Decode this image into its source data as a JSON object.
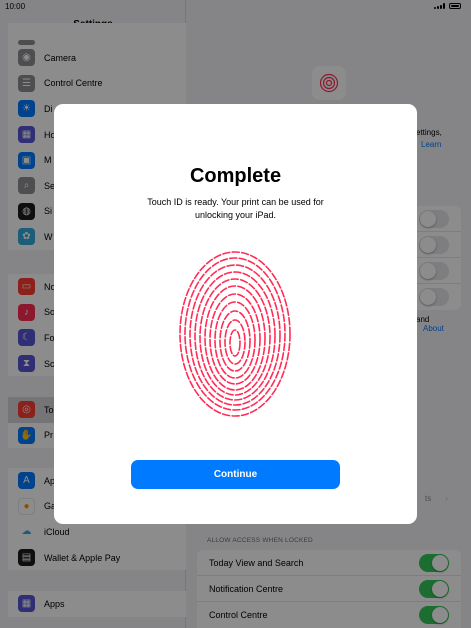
{
  "status_bar": {
    "time": "10:00"
  },
  "sidebar": {
    "title": "Settings",
    "groups": [
      {
        "items": [
          {
            "label": "",
            "icon": "generic-icon",
            "color": "#8e8e93"
          },
          {
            "label": "Camera",
            "icon": "camera-icon",
            "color": "#8e8e93"
          },
          {
            "label": "Control Centre",
            "icon": "control-centre-icon",
            "color": "#8e8e93"
          },
          {
            "label": "Di",
            "icon": "display-icon",
            "color": "#007aff"
          },
          {
            "label": "Ho",
            "icon": "home-screen-icon",
            "color": "#5856d6"
          },
          {
            "label": "M",
            "icon": "multitasking-icon",
            "color": "#007aff"
          },
          {
            "label": "Se",
            "icon": "search-icon",
            "color": "#8e8e93"
          },
          {
            "label": "Si",
            "icon": "siri-icon",
            "color": "#1c1c1e"
          },
          {
            "label": "W",
            "icon": "wallpaper-icon",
            "color": "#34aadc"
          }
        ]
      },
      {
        "items": [
          {
            "label": "No",
            "icon": "notifications-icon",
            "color": "#ff3b30"
          },
          {
            "label": "So",
            "icon": "sounds-icon",
            "color": "#ff2d55"
          },
          {
            "label": "Fo",
            "icon": "focus-icon",
            "color": "#5856d6"
          },
          {
            "label": "Sc",
            "icon": "screen-time-icon",
            "color": "#5856d6"
          }
        ]
      },
      {
        "items": [
          {
            "label": "To",
            "icon": "touch-id-icon",
            "color": "#ff3b30",
            "selected": true
          },
          {
            "label": "Pr",
            "icon": "privacy-icon",
            "color": "#007aff"
          }
        ]
      },
      {
        "items": [
          {
            "label": "Ap",
            "icon": "app-store-icon",
            "color": "#007aff"
          },
          {
            "label": "Ga",
            "icon": "game-center-icon",
            "color": "#ffffff"
          },
          {
            "label": "iCloud",
            "icon": "icloud-icon",
            "color": "#ffffff"
          },
          {
            "label": "Wallet & Apple Pay",
            "icon": "wallet-icon",
            "color": "#1c1c1e"
          }
        ]
      },
      {
        "items": [
          {
            "label": "Apps",
            "icon": "apps-icon",
            "color": "#5856d6"
          }
        ]
      }
    ]
  },
  "detail": {
    "text_settings": "ettings,",
    "text_learn": "Learn",
    "text_and": "and",
    "text_about": "About",
    "text_more": "ts",
    "allow_access_header": "ALLOW ACCESS WHEN LOCKED",
    "locked_rows": [
      {
        "label": "Today View and Search",
        "on": true
      },
      {
        "label": "Notification Centre",
        "on": true
      },
      {
        "label": "Control Centre",
        "on": true
      }
    ]
  },
  "modal": {
    "title": "Complete",
    "body": "Touch ID is ready. Your print can be used for unlocking your iPad.",
    "continue_label": "Continue",
    "accent_color": "#007aff",
    "fingerprint_color": "#ff2d55"
  }
}
